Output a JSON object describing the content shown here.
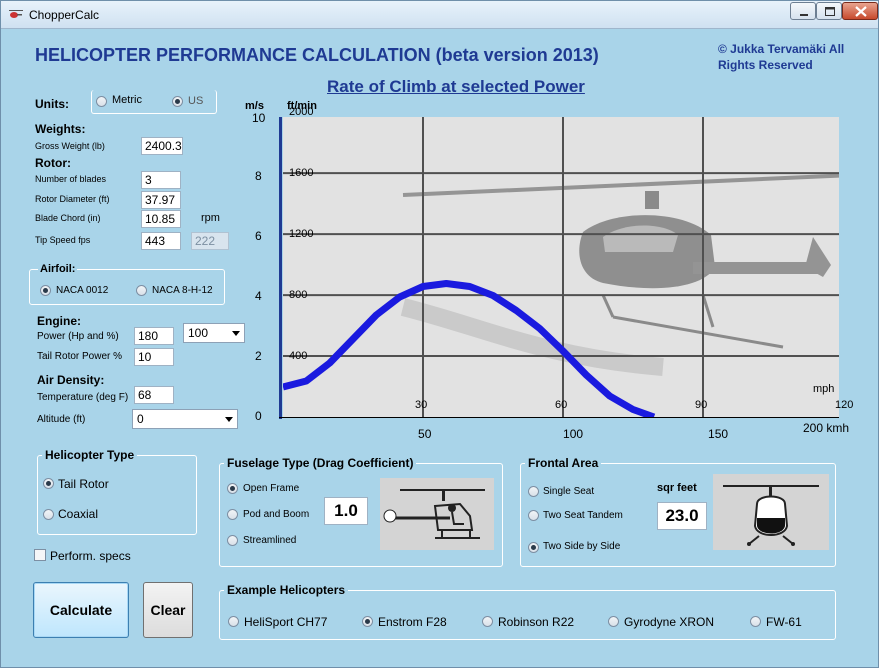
{
  "window": {
    "title": "ChopperCalc"
  },
  "header": {
    "title": "HELICOPTER PERFORMANCE CALCULATION  (beta version 2013)",
    "copyright_line1": "© Jukka Tervamäki All",
    "copyright_line2": "Rights Reserved"
  },
  "units": {
    "label": "Units:",
    "metric": "Metric",
    "us": "US",
    "selected": "US"
  },
  "weights": {
    "label": "Weights:",
    "gross_label": "Gross Weight (lb)",
    "gross_value": "2400.3"
  },
  "rotor": {
    "label": "Rotor:",
    "blades_label": "Number of blades",
    "blades_value": "3",
    "diameter_label": "Rotor Diameter (ft)",
    "diameter_value": "37.97",
    "chord_label": "Blade Chord (in)",
    "chord_value": "10.85",
    "rpm_label": "rpm",
    "tip_label": "Tip Speed fps",
    "tip_value": "443",
    "rpm_value": "222"
  },
  "airfoil": {
    "label": "Airfoil:",
    "opt1": "NACA 0012",
    "opt2": "NACA 8-H-12",
    "selected": "NACA 0012"
  },
  "engine": {
    "label": "Engine:",
    "power_label": "Power (Hp and %)",
    "power_value": "180",
    "power_pct": "100",
    "tail_label": "Tail Rotor Power %",
    "tail_value": "10"
  },
  "air": {
    "label": "Air Density:",
    "temp_label": "Temperature (deg F)",
    "temp_value": "68",
    "alt_label": "Altitude (ft)",
    "alt_value": "0"
  },
  "heli_type": {
    "label": "Helicopter Type",
    "opt1": "Tail Rotor",
    "opt2": "Coaxial",
    "selected": "Tail Rotor"
  },
  "perform_specs": "Perform. specs",
  "buttons": {
    "calculate": "Calculate",
    "clear": "Clear"
  },
  "fuselage": {
    "label": "Fuselage Type (Drag Coefficient)",
    "opt1": "Open Frame",
    "opt2": "Pod and Boom",
    "opt3": "Streamlined",
    "selected": "Open Frame",
    "value": "1.0"
  },
  "frontal": {
    "label": "Frontal Area",
    "opt1": "Single Seat",
    "opt2": "Two Seat Tandem",
    "opt3": "Two Side by Side",
    "selected": "Two Side by Side",
    "unit": "sqr feet",
    "value": "23.0"
  },
  "examples": {
    "label": "Example Helicopters",
    "items": [
      "HeliSport CH77",
      "Enstrom F28",
      "Robinson R22",
      "Gyrodyne XRON",
      "FW-61"
    ],
    "selected": "Enstrom F28"
  },
  "chart_data": {
    "type": "line",
    "title": "Rate of Climb at selected Power",
    "left_axis_unit": "m/s",
    "left_ticks": [
      "0",
      "2",
      "4",
      "6",
      "8",
      "10"
    ],
    "right_axis_unit": "ft/min",
    "right_ticks": [
      "400",
      "800",
      "1200",
      "1600",
      "2000"
    ],
    "mph_unit": "mph",
    "mph_ticks": [
      "30",
      "60",
      "90",
      "120"
    ],
    "kmh_ticks": [
      "50",
      "100",
      "150"
    ],
    "kmh_last": "200 kmh",
    "xlim_mph": [
      0,
      120
    ],
    "ylim_ms": [
      0,
      10
    ],
    "grid": true,
    "series": [
      {
        "x_mph": [
          0,
          5,
          10,
          15,
          20,
          25,
          30,
          35,
          40,
          45,
          50,
          55,
          60,
          65,
          70,
          75,
          79.5
        ],
        "y_ms": [
          1.0,
          1.2,
          1.8,
          2.6,
          3.4,
          4.0,
          4.35,
          4.45,
          4.35,
          4.05,
          3.55,
          2.95,
          2.2,
          1.4,
          0.7,
          0.25,
          0.0
        ]
      }
    ],
    "colors": {
      "series": "#1a1adf",
      "axis": "#1f3a93",
      "grid": "#505050"
    }
  }
}
